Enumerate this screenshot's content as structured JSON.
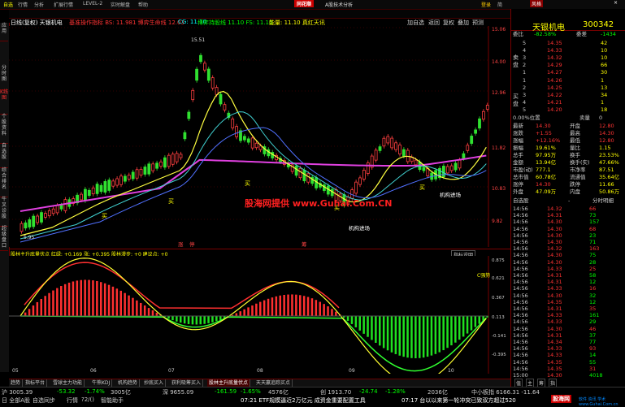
{
  "menubar": {
    "items": [
      "自选",
      "行情",
      "分析",
      "扩展行情",
      "LEVEL-2",
      "实时解盘",
      "帮助"
    ],
    "app_title": "A股技术分析",
    "logo": "同花顺",
    "user": "登录",
    "win": "简",
    "style": "风格",
    "close": "×"
  },
  "left_tabs": [
    "应用",
    "分时图",
    "K线图",
    "个股资料",
    "自选股",
    "综合排名",
    "牛叉诊股",
    "超级盘口"
  ],
  "toolbar": {
    "stock": "日线(复权) 天银机电",
    "indicators": "基准操作指标 BS: 11.981 博弈生命线 12.03",
    "cg": "CG: 11.10",
    "ctrl": "博弈持股线 11.10 FS: 11.10",
    "boll": "能量: 11.10 真红天讯",
    "buttons": [
      "加自选",
      "返回",
      "复权",
      "叠加",
      "预测"
    ]
  },
  "price_axis": [
    "15.06",
    "14.00",
    "12.96",
    "11.82",
    "10.83",
    "9.82"
  ],
  "price_marks": [
    "15.51",
    "5.95"
  ],
  "chart_labels": {
    "buy1": "买",
    "buy2": "买",
    "buy3": "买",
    "buy4": "买",
    "buy5": "买",
    "inst1": "机构进场",
    "inst2": "机构进场",
    "zhang": "涨",
    "ting": "停",
    "chou": "筹"
  },
  "watermark": "股海网提供 www.Guhai.Com.CN",
  "sub": {
    "title": "股林主升底量伏点 红绿: +0.169 涨: +0.395 股林漫步: +0 建议点: +0",
    "note": "指标说明",
    "axis": [
      "0.875",
      "0.621",
      "0.367",
      "0.113",
      "-0.141",
      "-0.395"
    ],
    "buy": "C强势",
    "date_labels": [
      "05",
      "06",
      "07",
      "08",
      "09",
      "10"
    ]
  },
  "right": {
    "name": "天银机电",
    "code": "300342",
    "ratio_label": "委比",
    "ratio": "-82.58%",
    "diff_label": "委差",
    "diff": "-1434",
    "sell_label": "卖盘",
    "buy_label": "买盘",
    "asks": [
      [
        "5",
        "14.35",
        "42"
      ],
      [
        "4",
        "14.33",
        "10"
      ],
      [
        "3",
        "14.32",
        "10"
      ],
      [
        "2",
        "14.29",
        "66"
      ],
      [
        "1",
        "14.27",
        "30"
      ]
    ],
    "bids": [
      [
        "1",
        "14.26",
        "1"
      ],
      [
        "2",
        "14.25",
        "13"
      ],
      [
        "3",
        "14.22",
        "34"
      ],
      [
        "4",
        "14.21",
        "1"
      ],
      [
        "5",
        "14.20",
        "18"
      ]
    ],
    "pos_label": "0.00%位置",
    "sell_label2": "卖量",
    "sell_val": "0",
    "stats": [
      [
        "最新",
        "14.30",
        "开盘",
        "12.80"
      ],
      [
        "涨跌",
        "+1.55",
        "最高",
        "14.30"
      ],
      [
        "涨幅",
        "+12.16%",
        "最低",
        "12.80"
      ],
      [
        "振幅",
        "19.61%",
        "量比",
        "1.15"
      ],
      [
        "总手",
        "97.95万",
        "换手",
        "23.53%"
      ],
      [
        "金额",
        "13.94亿",
        "换手(实)",
        "47.66%"
      ],
      [
        "市盈(动)",
        "777.1",
        "市净率",
        "87.51"
      ],
      [
        "总市值",
        "60.78亿",
        "流通值",
        "35.64亿"
      ],
      [
        "涨停",
        "14.30",
        "跌停",
        "11.66"
      ],
      [
        "外盘",
        "47.09万",
        "内盘",
        "50.86万"
      ]
    ],
    "tick_head": [
      "自选股",
      "-",
      "分时明细"
    ],
    "ticks": [
      [
        "14:56",
        "14.32",
        "66"
      ],
      [
        "14:56",
        "14.31",
        "73"
      ],
      [
        "14:56",
        "14.30",
        "157"
      ],
      [
        "14:56",
        "14.30",
        "68"
      ],
      [
        "14:56",
        "14.30",
        "23"
      ],
      [
        "14:56",
        "14.30",
        "71"
      ],
      [
        "14:56",
        "14.32",
        "163"
      ],
      [
        "14:56",
        "14.30",
        "75"
      ],
      [
        "14:56",
        "14.30",
        "28"
      ],
      [
        "14:56",
        "14.33",
        "25"
      ],
      [
        "14:56",
        "14.31",
        "58"
      ],
      [
        "14:56",
        "14.31",
        "12"
      ],
      [
        "14:56",
        "14.33",
        "16"
      ],
      [
        "14:56",
        "14.30",
        "32"
      ],
      [
        "14:56",
        "14.35",
        "12"
      ],
      [
        "14:56",
        "14.31",
        "35"
      ],
      [
        "14:56",
        "14.33",
        "161"
      ],
      [
        "14:56",
        "14.33",
        "29"
      ],
      [
        "14:56",
        "14.30",
        "46"
      ],
      [
        "14:56",
        "14.31",
        "37"
      ],
      [
        "14:56",
        "14.34",
        "77"
      ],
      [
        "14:56",
        "14.33",
        "93"
      ],
      [
        "14:56",
        "14.33",
        "14"
      ],
      [
        "14:56",
        "14.35",
        "55"
      ],
      [
        "14:56",
        "14.35",
        "31"
      ],
      [
        "15:00",
        "14.30",
        "4018"
      ]
    ],
    "bottom_tabs": [
      "值",
      "主",
      "筹",
      "指"
    ]
  },
  "bottom_tabs": [
    "趋势",
    "指标平台",
    "雪球主力功能",
    "牛熊KDJ",
    "机构趋势",
    "抄底买入",
    "获利吸筹买入",
    "股林主升底量伏点",
    "天天赢追踪买点"
  ],
  "status": {
    "sh": "沪 3005.39",
    "sh_chg": "-53.32",
    "sh_amt": "-1.74%",
    "sh_vol": "3005亿",
    "sz": "深 9655.09",
    "sz_chg": "-161.59",
    "sz_pct": "-1.65%",
    "sz_vol": "4576亿",
    "cy": "创 1913.70",
    "cy_chg": "-24.74",
    "cy_pct": "-1.28%",
    "cy_vol": "2036亿",
    "small": "中小板指 6166.31 -11.64",
    "news1": "07:21 ETF规模逼近2万亿元 成资金重要配置工具",
    "news2": "07:17 台以以来第一轮冲突已致双方超过520",
    "ticker_row": [
      "日 全部A股",
      "自选同步",
      "行情",
      "?2/()",
      "智能助手"
    ],
    "guhai": "股海网",
    "guhai_url": "软件 资讯 学术 www.Guhai.Com.cn"
  }
}
